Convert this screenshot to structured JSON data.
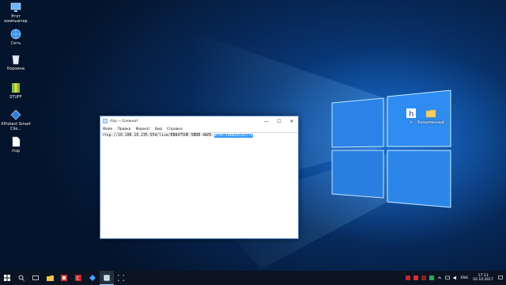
{
  "desktop": {
    "icons": [
      {
        "label": "Этот компьютер",
        "icon": "computer-icon"
      },
      {
        "label": "Сеть",
        "icon": "network-icon"
      },
      {
        "label": "Корзина",
        "icon": "recycle-bin-icon"
      },
      {
        "label": "STUFF",
        "icon": "archive-icon"
      },
      {
        "label": "XProtect Smart Clie...",
        "icon": "xprotect-icon"
      },
      {
        "label": "rtsp",
        "icon": "text-file-icon"
      }
    ],
    "wallpaper_icons": [
      {
        "label": "h",
        "icon": "h-app-icon"
      },
      {
        "label": "Безымянный",
        "icon": "folder-icon"
      }
    ]
  },
  "notepad": {
    "title": "rtsp — Блокнот",
    "menu": [
      "Файл",
      "Правка",
      "Формат",
      "Вид",
      "Справка"
    ],
    "content_plain": "rtsp://10.100.10.235:554/live/EB8475OE-5BDB-4A05-",
    "content_selected": "8F59-19682ECB3779",
    "buttons": {
      "minimize": "—",
      "maximize": "☐",
      "close": "✕"
    }
  },
  "taskbar": {
    "apps": [
      "start-icon",
      "search-icon",
      "task-view-icon",
      "explorer-icon",
      "app-red-icon",
      "app-red2-icon",
      "xprotect-icon",
      "notepad-icon",
      "screen-icon"
    ],
    "lang": "ENG",
    "time": "17:13",
    "date": "02.10.2017"
  },
  "colors": {
    "selection": "#3399ff",
    "accent": "#0078d7"
  }
}
